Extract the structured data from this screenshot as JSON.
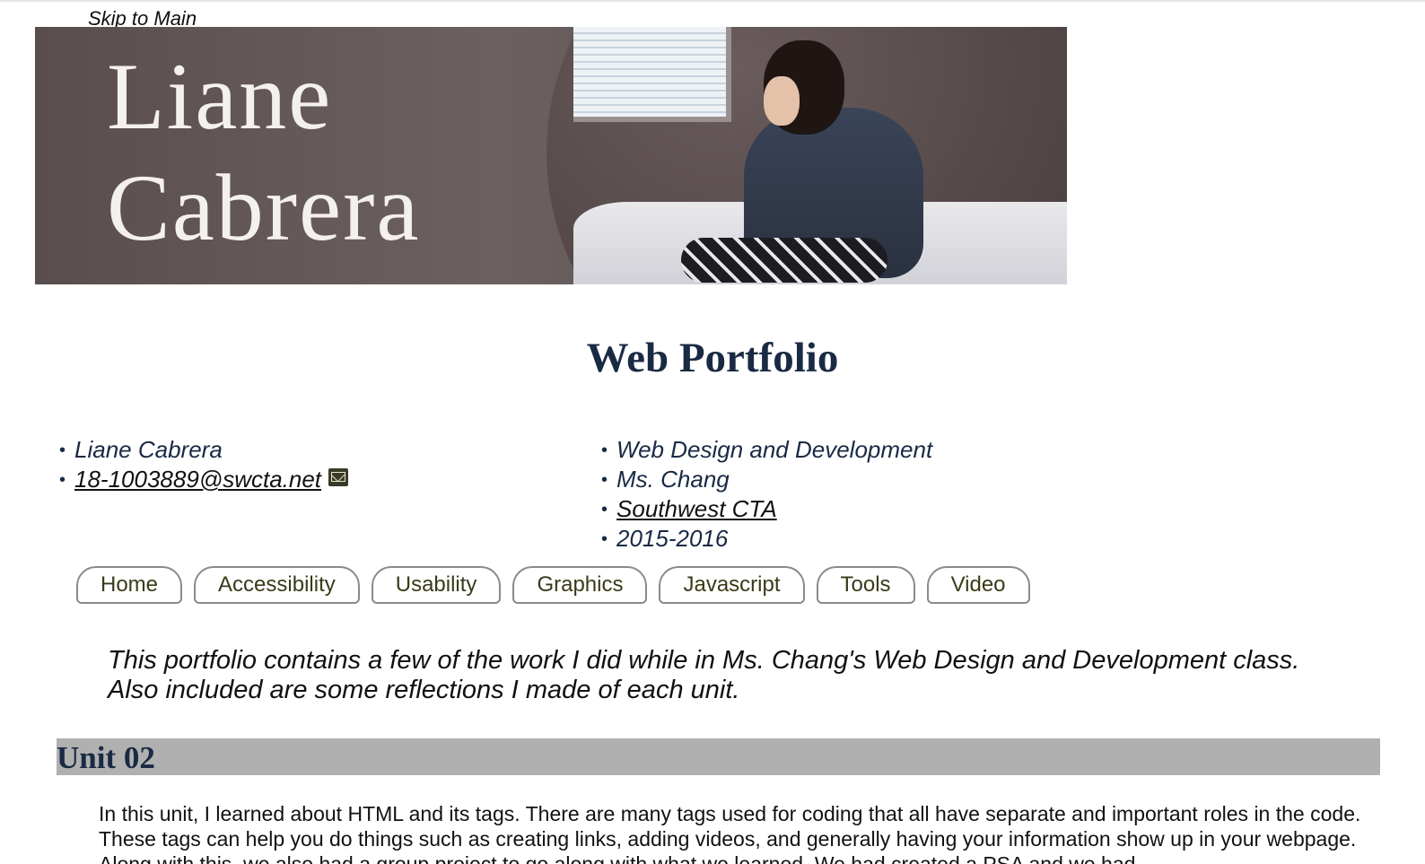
{
  "skip_link": "Skip to Main",
  "banner": {
    "name_line1": "Liane",
    "name_line2": "Cabrera"
  },
  "page_title": "Web Portfolio",
  "student": {
    "name": "Liane Cabrera",
    "email": "18-1003889@swcta.net"
  },
  "course": {
    "title": "Web Design and Development",
    "teacher": "Ms. Chang",
    "school": "Southwest CTA",
    "year": "2015-2016"
  },
  "nav": {
    "items": [
      "Home",
      "Accessibility",
      "Usability",
      "Graphics",
      "Javascript",
      "Tools",
      "Video"
    ]
  },
  "intro": {
    "line1": "This portfolio contains a few of the work I did while in Ms. Chang's Web Design and Development class.",
    "line2": "Also included are some reflections I made of each unit."
  },
  "unit": {
    "title": "Unit 02",
    "text": "In this unit, I learned about HTML and its tags. There are many tags used for coding that all have separate and important roles in the code. These tags can help you do things such as creating links, adding videos, and generally having your information show up in your webpage. Along with this, we also had a group project to go along with what we learned. We had created a PSA and we had"
  },
  "colors": {
    "heading": "#1a2a44",
    "unit_bar": "#b0b0b0",
    "nav_border": "#8a8a8a"
  }
}
